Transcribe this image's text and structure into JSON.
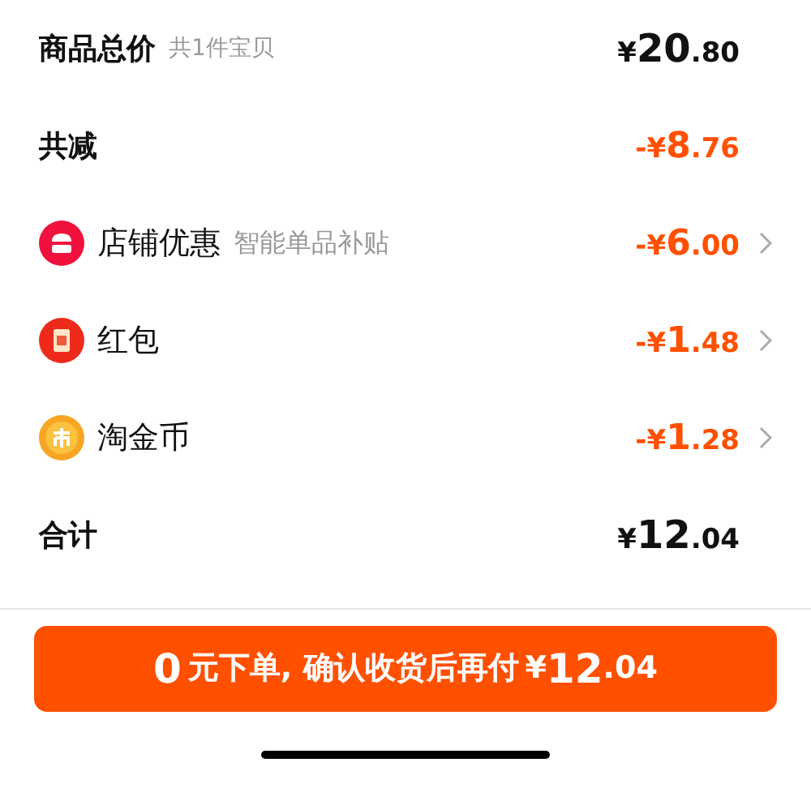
{
  "rows": [
    {
      "kind": "plain",
      "label": "商品总价",
      "note": "共1件宝贝",
      "price": {
        "sign": "¥",
        "int": "20",
        "dec": ".80"
      },
      "accent": false,
      "arrow": false
    },
    {
      "kind": "plain",
      "label": "共减",
      "price": {
        "sign": "-¥",
        "int": "8",
        "dec": ".76"
      },
      "accent": true,
      "arrow": false
    },
    {
      "kind": "store",
      "label": "店铺优惠",
      "note": "智能单品补贴",
      "price": {
        "sign": "-¥",
        "int": "6",
        "dec": ".00"
      },
      "accent": true,
      "arrow": true
    },
    {
      "kind": "redpacket",
      "label": "红包",
      "price": {
        "sign": "-¥",
        "int": "1",
        "dec": ".48"
      },
      "accent": true,
      "arrow": true
    },
    {
      "kind": "coin",
      "label": "淘金币",
      "price": {
        "sign": "-¥",
        "int": "1",
        "dec": ".28"
      },
      "accent": true,
      "arrow": true
    },
    {
      "kind": "plain",
      "label": "合计",
      "price": {
        "sign": "¥",
        "int": "12",
        "dec": ".04"
      },
      "accent": false,
      "arrow": false
    }
  ],
  "pay_button": {
    "lead": "0",
    "text": "元下单, 确认收货后再付",
    "sign": "¥",
    "int": "12",
    "dec": ".04"
  }
}
